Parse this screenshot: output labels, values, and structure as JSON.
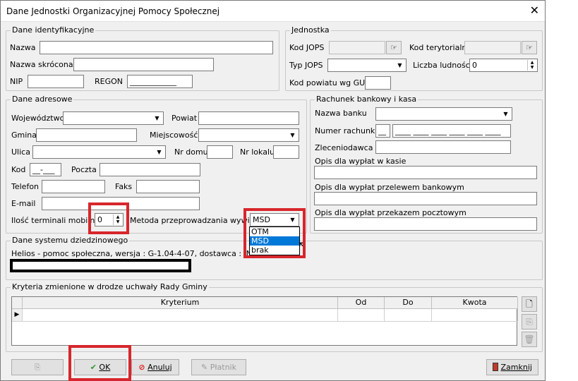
{
  "window": {
    "title": "Dane Jednostki Organizacyjnej Pomocy Społecznej",
    "close": "✕"
  },
  "ident": {
    "legend": "Dane identyfikacyjne",
    "nazwa_label": "Nazwa",
    "nazwa_value": "",
    "nazwa_skrocona_label": "Nazwa skrócona",
    "nazwa_skrocona_value": "",
    "nip_label": "NIP",
    "nip_value": "",
    "regon_label": "REGON",
    "regon_value": "____________"
  },
  "jednostka": {
    "legend": "Jednostka",
    "kod_jops_label": "Kod JOPS",
    "kod_jops_value": "",
    "kod_tery_label": "Kod terytorialny",
    "kod_tery_value": "",
    "typ_jops_label": "Typ JOPS",
    "typ_jops_value": "",
    "liczba_label": "Liczba ludności",
    "liczba_value": "0",
    "kod_powiatu_label": "Kod powiatu wg GUS",
    "kod_powiatu_value": ""
  },
  "adres": {
    "legend": "Dane adresowe",
    "woj_label": "Województwo",
    "woj_value": "",
    "powiat_label": "Powiat",
    "powiat_value": "",
    "gmina_label": "Gmina",
    "gmina_value": "",
    "miejsc_label": "Miejscowość",
    "miejsc_value": "",
    "ulica_label": "Ulica",
    "ulica_value": "",
    "nr_domu_label": "Nr domu",
    "nr_domu_value": "",
    "nr_lokalu_label": "Nr lokalu",
    "nr_lokalu_value": "",
    "kod_label": "Kod",
    "kod_value": "__-___",
    "poczta_label": "Poczta",
    "poczta_value": "",
    "telefon_label": "Telefon",
    "telefon_value": "",
    "faks_label": "Faks",
    "faks_value": "",
    "email_label": "E-mail",
    "email_value": "",
    "ilosc_label": "Ilość terminali mobilnych",
    "ilosc_value": "0",
    "metoda_label": "Metoda przeprowadzania wywiadu",
    "metoda_value": "MSD",
    "metoda_options": [
      "OTM",
      "MSD",
      "brak"
    ],
    "metoda_selected_index": 1
  },
  "rachunek": {
    "legend": "Rachunek bankowy i kasa",
    "bank_label": "Nazwa banku",
    "bank_value": "",
    "numer_label": "Numer rachunku",
    "numer_prefix": "__",
    "numer_value": "____ ____ ____ ____ ____ ____",
    "zlecen_label": "Zleceniodawca",
    "zlecen_value": "",
    "opis_kasa_label": "Opis dla wypłat w kasie",
    "opis_kasa_value": "",
    "opis_przelew_label": "Opis dla wypłat przelewem bankowym",
    "opis_przelew_value": "",
    "opis_poczta_label": "Opis dla wypłat przekazem pocztowym",
    "opis_poczta_value": ""
  },
  "system": {
    "legend": "Dane systemu dziedzinowego",
    "info": "Helios - pomoc społeczna, wersja : G-1.04-4-07, dostawca : INFO-R S"
  },
  "kryteria": {
    "legend": "Kryteria zmienione w drodze uchwały Rady Gminy",
    "columns": [
      "Kryterium",
      "Od",
      "Do",
      "Kwota"
    ],
    "row_marker": "▶"
  },
  "buttons": {
    "ok": "OK",
    "anuluj": "Anuluj",
    "platnik": "Płatnik",
    "zamknij": "Zamknij"
  }
}
